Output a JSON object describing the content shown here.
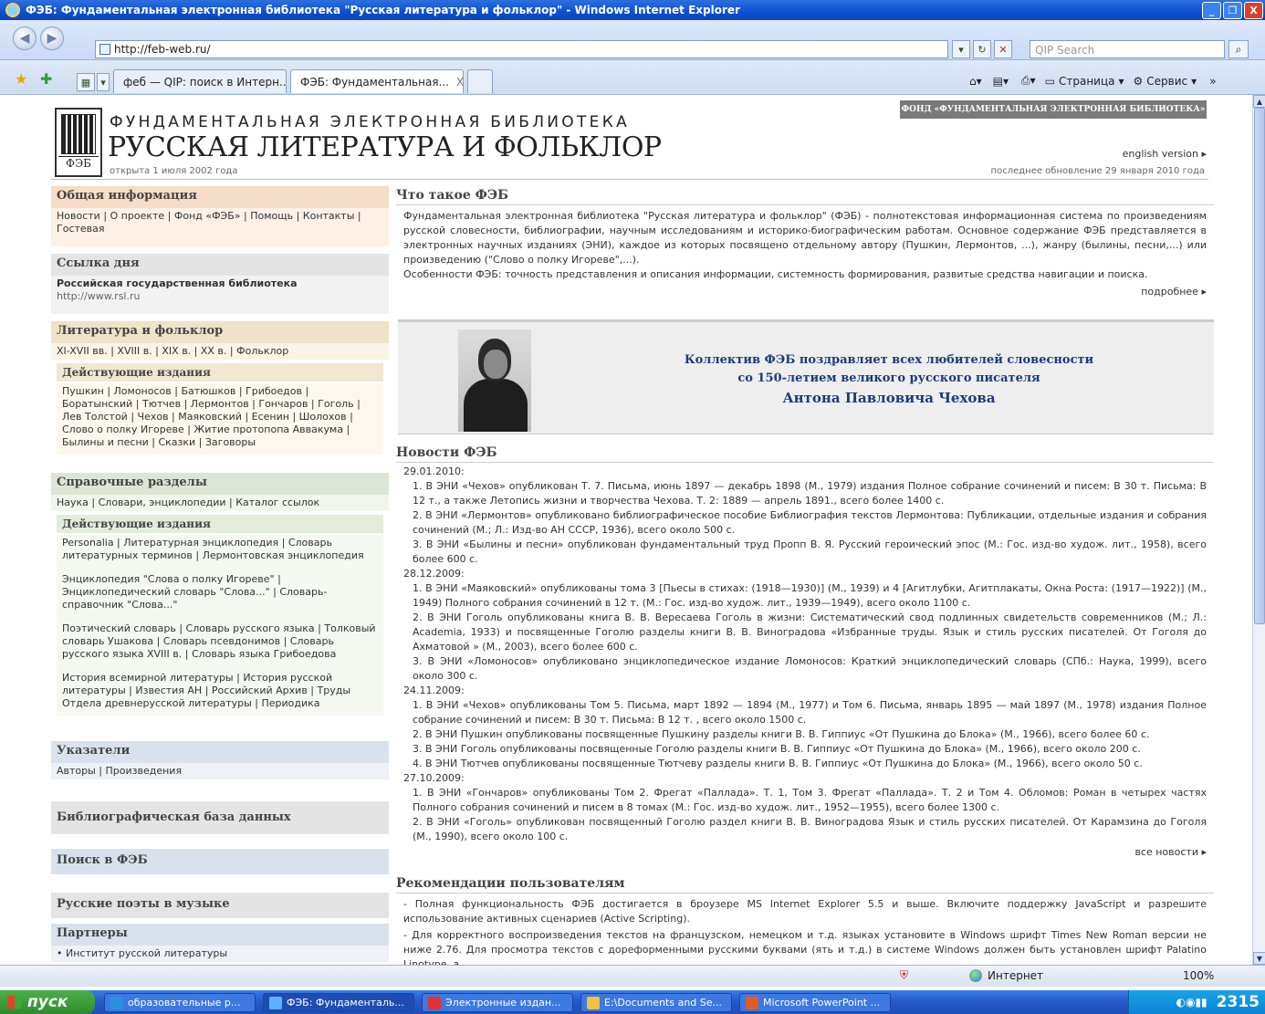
{
  "window": {
    "title": "ФЭБ: Фундаментальная электронная библиотека \"Русская литература и фольклор\" - Windows Internet Explorer",
    "minimize": "_",
    "maximize": "❐",
    "close": "X"
  },
  "browser": {
    "back": "◀",
    "forward": "▶",
    "url": "http://feb-web.ru/",
    "search_placeholder": "QIP Search",
    "tabs": [
      {
        "label": "феб — QIP: поиск в Интерн...",
        "active": false
      },
      {
        "label": "ФЭБ: Фундаментальная...",
        "active": true
      }
    ],
    "tab_close": "X",
    "page_menu": "Страница",
    "tools_menu": "Сервис",
    "overflow": "»",
    "status_zone": "Интернет",
    "zoom": "100%"
  },
  "site": {
    "subtitle": "ФУНДАМЕНТАЛЬНАЯ ЭЛЕКТРОННАЯ БИБЛИОТЕКА",
    "title": "РУССКАЯ ЛИТЕРАТУРА И ФОЛЬКЛОР",
    "logo_text": "ФЭБ",
    "opened": "открыта 1 июля 2002 года",
    "fund": "ФОНД «ФУНДАМЕНТАЛЬНАЯ ЭЛЕКТРОННАЯ БИБЛИОТЕКА»",
    "english": "english version ▸",
    "updated": "последнее обновление 29 января 2010 года"
  },
  "left": {
    "general": {
      "title": "Общая информация",
      "links": "Новости | О проекте | Фонд «ФЭБ» | Помощь | Контакты | Гостевая"
    },
    "link_of_day": {
      "title": "Ссылка дня",
      "name": "Российская государственная библиотека",
      "url": "http://www.rsl.ru"
    },
    "literature": {
      "title": "Литература и фольклор",
      "links": "XI-XVII вв. | XVIII в. | XIX в. | XX в. | Фольклор",
      "sub_title": "Действующие издания",
      "sub_links": "Пушкин | Ломоносов | Батюшков | Грибоедов | Боратынский | Тютчев | Лермонтов | Гончаров | Гоголь | Лев Толстой | Чехов | Маяковский | Есенин | Шолохов | Слово о полку Игореве | Житие протопопа Аввакума | Былины и песни | Сказки | Заговоры"
    },
    "reference": {
      "title": "Справочные разделы",
      "links": "Наука | Словари, энциклопедии | Каталог ссылок",
      "sub_title": "Действующие издания",
      "group1": "Personalia | Литературная энциклопедия | Словарь литературных терминов | Лермонтовская энциклопедия",
      "group2": "Энциклопедия \"Слова о полку Игореве\" | Энциклопедический словарь \"Слова...\" | Словарь-справочник \"Слова...\"",
      "group3": "Поэтический словарь | Словарь русского языка | Толковый словарь Ушакова | Словарь псевдонимов | Словарь русского языка XVIII в. | Словарь языка Грибоедова",
      "group4": "История всемирной литературы | История русской литературы | Известия АН | Российский Архив | Труды Отдела древнерусской литературы | Периодика"
    },
    "indexes": {
      "title": "Указатели",
      "links": "Авторы | Произведения"
    },
    "bibliography": {
      "title": "Библиографическая база данных"
    },
    "search": {
      "title": "Поиск в ФЭБ"
    },
    "poets": {
      "title": "Русские поэты в музыке"
    },
    "partners": {
      "title": "Партнеры",
      "item1": "• Институт русской литературы"
    }
  },
  "main": {
    "what_title": "Что такое ФЭБ",
    "what_text1": "Фундаментальная электронная библиотека \"Русская литература и фольклор\" (ФЭБ) - полнотекстовая информационная система по произведениям русской словесности, библиографии, научным исследованиям и историко-биографическим работам. Основное содержание ФЭБ представляется в электронных научных изданиях (ЭНИ), каждое из которых посвящено отдельному автору (Пушкин, Лермонтов, ...), жанру (былины, песни,...) или произведению (\"Слово о полку Игореве\",...).",
    "what_text2": "Особенности ФЭБ: точность представления и описания информации, системность формирования, развитые средства навигации и поиска.",
    "more": "подробнее ▸",
    "banner1": "Коллектив ФЭБ поздравляет всех любителей словесности",
    "banner2": "со 150-летием великого русского писателя",
    "banner3": "Антона Павловича Чехова",
    "news_title": "Новости ФЭБ",
    "news": [
      {
        "date": "29.01.2010:",
        "items": [
          "1. В ЭНИ «Чехов» опубликован Т. 7. Письма, июнь 1897 — декабрь 1898 (М., 1979) издания Полное собрание сочинений и писем: В 30 т. Письма: В 12 т., а также Летопись жизни и творчества Чехова. Т. 2: 1889 — апрель 1891., всего более 1400 с.",
          "2. В ЭНИ «Лермонтов» опубликовано библиографическое пособие Библиография текстов Лермонтова: Публикации, отдельные издания и собрания сочинений (М.; Л.: Изд-во АН СССР, 1936), всего около 500 с.",
          "3. В ЭНИ «Былины и песни» опубликован фундаментальный труд Пропп В. Я. Русский героический эпос (М.: Гос. изд-во худож. лит., 1958), всего более 600 с."
        ]
      },
      {
        "date": "28.12.2009:",
        "items": [
          "1. В ЭНИ «Маяковский» опубликованы тома 3 [Пьесы в стихах: (1918—1930)] (М., 1939) и 4 [Агитлубки, Агитплакаты, Окна Роста: (1917—1922)] (М., 1949) Полного собрания сочинений в 12 т. (М.: Гос. изд-во худож. лит., 1939—1949), всего около 1100 с.",
          "2. В ЭНИ Гоголь опубликованы книга В. В. Вересаева Гоголь в жизни: Систематический свод подлинных свидетельств современников (М.; Л.: Academia, 1933) и посвященные Гоголю разделы книги В. В. Виноградова «Избранные труды. Язык и стиль русских писателей. От Гоголя до Ахматовой » (М., 2003), всего более 600 с.",
          "3. В ЭНИ «Ломоносов» опубликовано энциклопедическое издание Ломоносов: Краткий энциклопедический словарь (СПб.: Наука, 1999), всего около 300 с."
        ]
      },
      {
        "date": "24.11.2009:",
        "items": [
          "1. В ЭНИ «Чехов» опубликованы Том 5. Письма, март 1892 — 1894 (М., 1977) и Том 6. Письма, январь 1895 — май 1897 (М., 1978) издания Полное собрание сочинений и писем: В 30 т. Письма: В 12 т. , всего около 1500 с.",
          "2. В ЭНИ Пушкин опубликованы посвященные Пушкину разделы книги В. В. Гиппиус «От Пушкина до Блока» (М., 1966), всего более 60 с.",
          "3. В ЭНИ Гоголь опубликованы посвященные Гоголю разделы книги В. В. Гиппиус «От Пушкина до Блока» (М., 1966), всего около 200 с.",
          "4. В ЭНИ Тютчев опубликованы посвященные Тютчеву разделы книги В. В. Гиппиус «От Пушкина до Блока» (М., 1966), всего около 50 с."
        ]
      },
      {
        "date": "27.10.2009:",
        "items": [
          "1. В ЭНИ «Гончаров» опубликованы Том 2. Фрегат «Паллада». Т. 1, Том 3. Фрегат «Паллада». Т. 2 и Том 4. Обломов: Роман в четырех частях Полного собрания сочинений и писем в 8 томах (М.: Гос. изд-во худож. лит., 1952—1955), всего более 1300 с.",
          "2. В ЭНИ «Гоголь» опубликован посвященный Гоголю раздел книги В. В. Виноградова Язык и стиль русских писателей. От Карамзина до Гоголя (М., 1990), всего около 100 с."
        ]
      }
    ],
    "all_news": "все новости ▸",
    "rec_title": "Рекомендации пользователям",
    "rec1": "- Полная функциональность ФЭБ достигается в броузере MS Internet Explorer 5.5 и выше. Включите поддержку JavaScript и разрешите использование активных сценариев (Active Scripting).",
    "rec2": "- Для корректного воспроизведения текстов на французском, немецком и т.д. языках установите в Windows шрифт Times New Roman версии не ниже 2.76. Для просмотра текстов с дореформенными русскими буквами (ять и т.д.) в системе Windows должен быть установлен шрифт Palatino Linotype, а"
  },
  "taskbar": {
    "start": "пуск",
    "tasks": [
      {
        "label": "образовательные р...",
        "color": "#2d8fe0"
      },
      {
        "label": "ФЭБ: Фундаменталь...",
        "color": "#5ab2ff"
      },
      {
        "label": "Электронные издан...",
        "color": "#d33"
      },
      {
        "label": "E:\\Documents and Se...",
        "color": "#f0c040"
      },
      {
        "label": "Microsoft PowerPoint ...",
        "color": "#e05a2a"
      }
    ],
    "clock": "2315"
  }
}
